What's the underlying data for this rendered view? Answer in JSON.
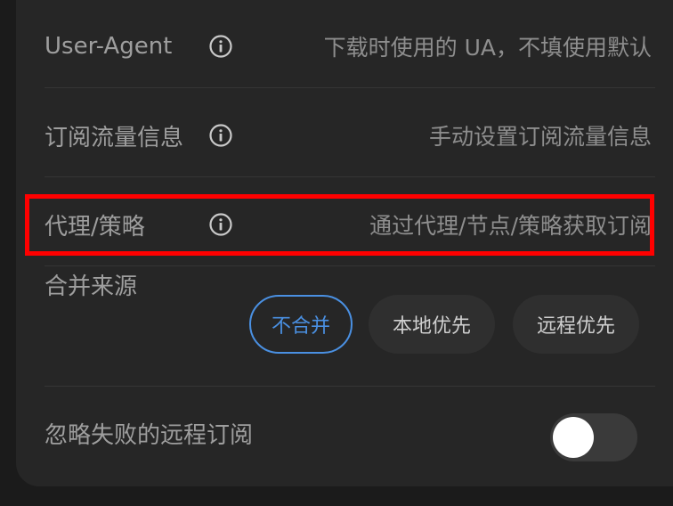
{
  "rows": {
    "user_agent": {
      "label": "User-Agent",
      "value": "下载时使用的 UA，不填使用默认"
    },
    "subscription_traffic": {
      "label": "订阅流量信息",
      "value": "手动设置订阅流量信息"
    },
    "proxy_policy": {
      "label": "代理/策略",
      "value": "通过代理/节点/策略获取订阅"
    },
    "merge_source": {
      "label": "合并来源",
      "options": [
        "不合并",
        "本地优先",
        "远程优先"
      ],
      "selected": "不合并"
    },
    "ignore_failed": {
      "label": "忽略失败的远程订阅",
      "enabled": false
    }
  },
  "colors": {
    "accent": "#4a90e2",
    "highlight": "#ff0000",
    "card_bg": "#262626",
    "page_bg": "#1b1b1b"
  },
  "icons": {
    "info": "info-circle-icon"
  }
}
